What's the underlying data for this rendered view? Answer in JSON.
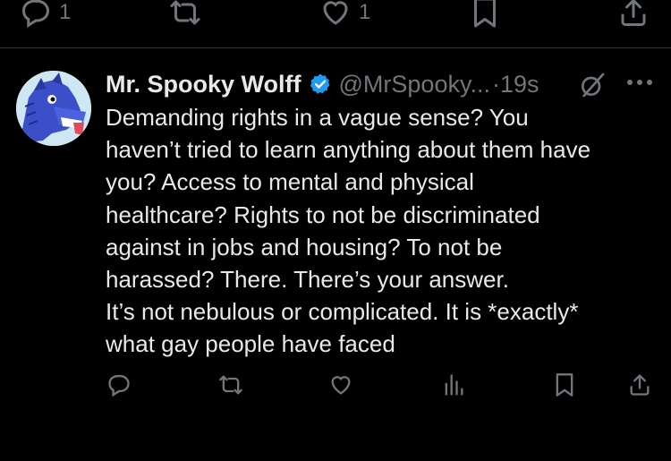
{
  "previous_tweet_actions": {
    "reply_count": "1",
    "like_count": "1"
  },
  "tweet": {
    "author_name": "Mr. Spooky Wolff",
    "handle": "@MrSpooky...",
    "time": "·19s",
    "lines": [
      "Demanding rights in a vague sense? You",
      "haven’t tried to learn anything about them have",
      "you? Access to mental and physical",
      "healthcare? Rights to not be discriminated",
      "against in jobs and housing? To not be",
      "harassed? There. There’s your answer.",
      "It’s not nebulous or complicated. It is *exactly*",
      "what gay people have faced"
    ]
  },
  "icons": {
    "reply": "reply-icon",
    "retweet": "retweet-icon",
    "like": "heart-icon",
    "views": "views-icon",
    "bookmark": "bookmark-icon",
    "share": "share-icon",
    "verified": "verified-badge-icon",
    "grok": "grok-icon",
    "more": "more-icon"
  },
  "colors": {
    "background": "#000000",
    "text": "#e7e9ea",
    "muted": "#71767b",
    "verified": "#1d9bf0"
  }
}
